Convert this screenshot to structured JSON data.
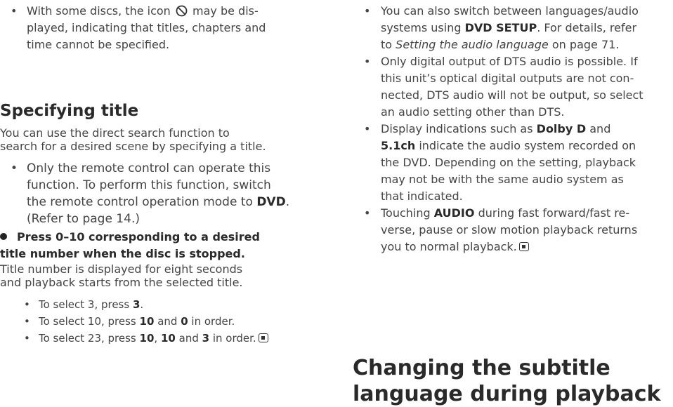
{
  "left": {
    "bullet_prohib": {
      "before_icon": "With some discs, the icon",
      "icon": "prohibited-icon",
      "line1_after": "may be dis-",
      "line2": "played, indicating that titles, chapters and",
      "line3": "time cannot be specified."
    },
    "heading": "Specifying title",
    "intro": {
      "line1": "You can use the direct search function to",
      "line2": "search for a desired scene by specifying a title."
    },
    "remote_bullet": {
      "line1": "Only the remote control can operate this",
      "line2": "function. To perform this function, switch",
      "line3_pre": "the remote control operation mode to",
      "line3_bold": "DVD",
      "line3_post": ".",
      "line4": "(Refer to page 14.)"
    },
    "step": {
      "line1": "Press 0–10 corresponding to a desired",
      "line2": "title number when the disc is stopped."
    },
    "result": {
      "line1": "Title number is displayed for eight seconds",
      "line2": "and playback starts from the selected title."
    },
    "examples": [
      {
        "pre": "To select 3, press",
        "k1": "3",
        "post": "."
      },
      {
        "pre": "To select 10, press",
        "k1": "10",
        "mid": "and",
        "k2": "0",
        "post": "in order."
      },
      {
        "pre": "To select 23, press",
        "k1": "10",
        "sep": ",",
        "k2": "10",
        "mid": "and",
        "k3": "3",
        "post": "in order."
      }
    ]
  },
  "right": {
    "b1": {
      "line1": "You can also switch between languages/audio",
      "line2_pre": "systems using",
      "line2_bold": "DVD SETUP",
      "line2_post": ". For details, refer",
      "line3_pre": "to",
      "line3_italic": "Setting the audio language",
      "line3_post": "on page 71."
    },
    "b2": {
      "line1": "Only digital output of DTS audio is possible. If",
      "line2": "this unit’s optical digital outputs are not con-",
      "line3": "nected, DTS audio will not be output, so select",
      "line4": "an audio setting other than DTS."
    },
    "b3": {
      "line1_pre": "Display indications such as",
      "line1_bold": "Dolby D",
      "line1_post": "and",
      "line2_bold": "5.1ch",
      "line2_post": "indicate the audio system recorded on",
      "line3": "the DVD. Depending on the setting, playback",
      "line4": "may not be with the same audio system as",
      "line5": "that indicated."
    },
    "b4": {
      "line1_pre": "Touching",
      "line1_bold": "AUDIO",
      "line1_post": "during fast forward/fast re-",
      "line2": "verse, pause or slow motion playback returns",
      "line3": "you to normal playback."
    },
    "heading": {
      "line1": "Changing the subtitle",
      "line2": "language during playback"
    }
  }
}
